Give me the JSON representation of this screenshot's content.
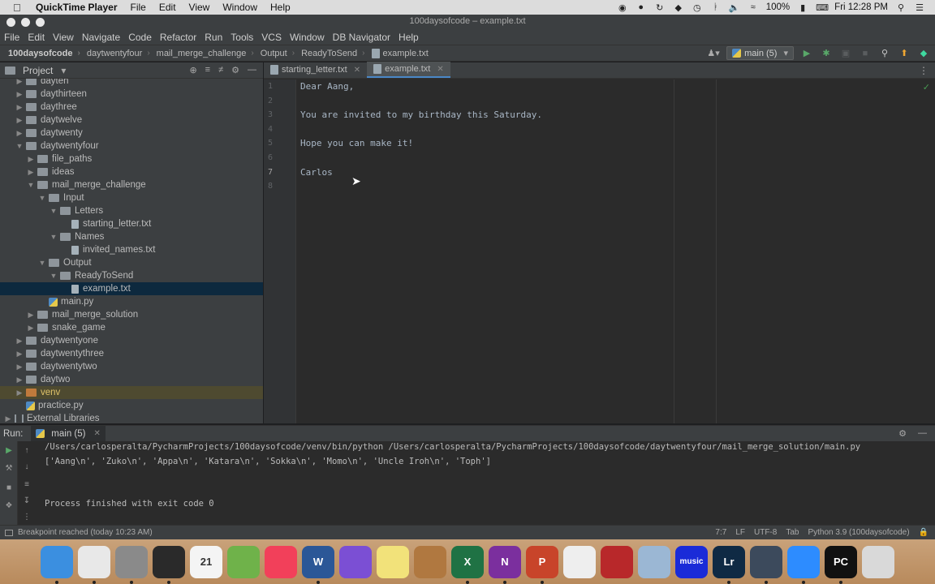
{
  "menubar": {
    "app_name": "QuickTime Player",
    "items": [
      "File",
      "Edit",
      "View",
      "Window",
      "Help"
    ],
    "battery": "100%",
    "clock": "Fri 12:28 PM"
  },
  "window": {
    "title": "100daysofcode – example.txt"
  },
  "ide_menu": [
    "File",
    "Edit",
    "View",
    "Navigate",
    "Code",
    "Refactor",
    "Run",
    "Tools",
    "VCS",
    "Window",
    "DB Navigator",
    "Help"
  ],
  "breadcrumbs": [
    "100daysofcode",
    "daytwentyfour",
    "mail_merge_challenge",
    "Output",
    "ReadyToSend",
    "example.txt"
  ],
  "run_config": "main (5)",
  "project": {
    "title": "Project",
    "tree": [
      {
        "label": "dayten",
        "depth": 1,
        "kind": "folder",
        "arrow": "right"
      },
      {
        "label": "daythirteen",
        "depth": 1,
        "kind": "folder",
        "arrow": "right"
      },
      {
        "label": "daythree",
        "depth": 1,
        "kind": "folder",
        "arrow": "right"
      },
      {
        "label": "daytwelve",
        "depth": 1,
        "kind": "folder",
        "arrow": "right"
      },
      {
        "label": "daytwenty",
        "depth": 1,
        "kind": "folder",
        "arrow": "right"
      },
      {
        "label": "daytwentyfour",
        "depth": 1,
        "kind": "folder",
        "arrow": "down"
      },
      {
        "label": "file_paths",
        "depth": 2,
        "kind": "folder",
        "arrow": "right"
      },
      {
        "label": "ideas",
        "depth": 2,
        "kind": "folder",
        "arrow": "right"
      },
      {
        "label": "mail_merge_challenge",
        "depth": 2,
        "kind": "folder",
        "arrow": "down"
      },
      {
        "label": "Input",
        "depth": 3,
        "kind": "folder",
        "arrow": "down"
      },
      {
        "label": "Letters",
        "depth": 4,
        "kind": "folder",
        "arrow": "down"
      },
      {
        "label": "starting_letter.txt",
        "depth": 5,
        "kind": "doc",
        "arrow": ""
      },
      {
        "label": "Names",
        "depth": 4,
        "kind": "folder",
        "arrow": "down"
      },
      {
        "label": "invited_names.txt",
        "depth": 5,
        "kind": "doc",
        "arrow": ""
      },
      {
        "label": "Output",
        "depth": 3,
        "kind": "folder",
        "arrow": "down"
      },
      {
        "label": "ReadyToSend",
        "depth": 4,
        "kind": "folder",
        "arrow": "down"
      },
      {
        "label": "example.txt",
        "depth": 5,
        "kind": "doc",
        "arrow": "",
        "selected": true
      },
      {
        "label": "main.py",
        "depth": 3,
        "kind": "py",
        "arrow": ""
      },
      {
        "label": "mail_merge_solution",
        "depth": 2,
        "kind": "folder",
        "arrow": "right"
      },
      {
        "label": "snake_game",
        "depth": 2,
        "kind": "folder",
        "arrow": "right"
      },
      {
        "label": "daytwentyone",
        "depth": 1,
        "kind": "folder",
        "arrow": "right"
      },
      {
        "label": "daytwentythree",
        "depth": 1,
        "kind": "folder",
        "arrow": "right"
      },
      {
        "label": "daytwentytwo",
        "depth": 1,
        "kind": "folder",
        "arrow": "right"
      },
      {
        "label": "daytwo",
        "depth": 1,
        "kind": "folder",
        "arrow": "right"
      },
      {
        "label": "venv",
        "depth": 1,
        "kind": "folder-orange",
        "arrow": "right",
        "venv": true
      },
      {
        "label": "practice.py",
        "depth": 1,
        "kind": "py",
        "arrow": ""
      },
      {
        "label": "External Libraries",
        "depth": 0,
        "kind": "lib",
        "arrow": "right"
      }
    ]
  },
  "editor": {
    "tabs": [
      {
        "label": "starting_letter.txt",
        "active": false
      },
      {
        "label": "example.txt",
        "active": true
      }
    ],
    "lines": [
      "Dear Aang,",
      "",
      "You are invited to my birthday this Saturday.",
      "",
      "Hope you can make it!",
      "",
      "Carlos",
      ""
    ],
    "line_numbers": [
      "1",
      "2",
      "3",
      "4",
      "5",
      "6",
      "7",
      "8"
    ],
    "current_line": 7
  },
  "run": {
    "label": "Run:",
    "tab": "main (5)",
    "console": [
      "/Users/carlosperalta/PycharmProjects/100daysofcode/venv/bin/python /Users/carlosperalta/PycharmProjects/100daysofcode/daytwentyfour/mail_merge_solution/main.py",
      "['Aang\\n', 'Zuko\\n', 'Appa\\n', 'Katara\\n', 'Sokka\\n', 'Momo\\n', 'Uncle Iroh\\n', 'Toph']",
      "",
      "Process finished with exit code 0"
    ]
  },
  "status": {
    "message": "Breakpoint reached (today 10:23 AM)",
    "position": "7:7",
    "line_sep": "LF",
    "encoding": "UTF-8",
    "indent": "Tab",
    "interpreter": "Python 3.9 (100daysofcode)"
  },
  "dock": {
    "apps": [
      {
        "name": "finder",
        "color": "#3b8fe0",
        "label": ""
      },
      {
        "name": "chrome",
        "color": "#e8e8e8",
        "label": ""
      },
      {
        "name": "system-preferences",
        "color": "#8a8a8a",
        "label": ""
      },
      {
        "name": "activity-monitor",
        "color": "#2a2a2a",
        "label": ""
      },
      {
        "name": "calendar",
        "color": "#f4f4f4",
        "label": "21"
      },
      {
        "name": "android-studio",
        "color": "#6fb24a",
        "label": ""
      },
      {
        "name": "music",
        "color": "#f2405a",
        "label": ""
      },
      {
        "name": "word",
        "color": "#2b5797",
        "label": "W"
      },
      {
        "name": "imovie",
        "color": "#7b4fd4",
        "label": ""
      },
      {
        "name": "stickies",
        "color": "#f2e27a",
        "label": ""
      },
      {
        "name": "garageband",
        "color": "#b07840",
        "label": ""
      },
      {
        "name": "excel",
        "color": "#1f7244",
        "label": "X"
      },
      {
        "name": "onenote",
        "color": "#7b2f9e",
        "label": "N"
      },
      {
        "name": "powerpoint",
        "color": "#c8442a",
        "label": "P"
      },
      {
        "name": "textedit",
        "color": "#eeeeee",
        "label": ""
      },
      {
        "name": "photo-booth",
        "color": "#b8282a",
        "label": ""
      },
      {
        "name": "preview",
        "color": "#9bb7d4",
        "label": ""
      },
      {
        "name": "amazon-music",
        "color": "#1a2bd8",
        "label": "music"
      },
      {
        "name": "lightroom",
        "color": "#0f2a44",
        "label": "Lr"
      },
      {
        "name": "quicktime",
        "color": "#3c4a5c",
        "label": ""
      },
      {
        "name": "zoom",
        "color": "#2d8cff",
        "label": ""
      },
      {
        "name": "pycharm",
        "color": "#111111",
        "label": "PC"
      },
      {
        "name": "trash",
        "color": "#d9d9d9",
        "label": ""
      }
    ]
  }
}
